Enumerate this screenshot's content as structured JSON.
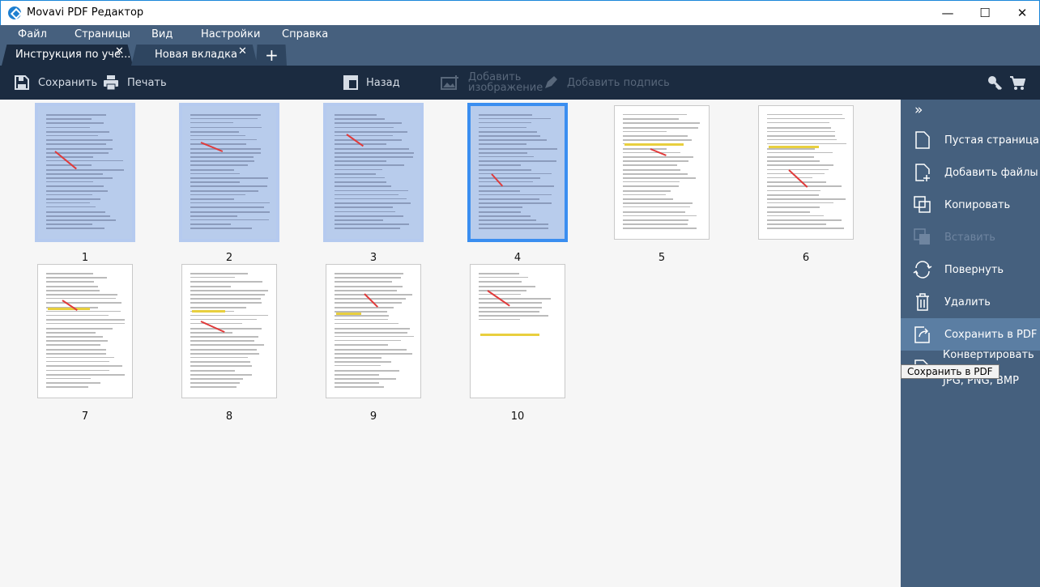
{
  "window": {
    "title": "Movavi PDF Редактор",
    "minimize": "—",
    "maximize": "☐",
    "close": "✕"
  },
  "menu": [
    "Файл",
    "Страницы",
    "Вид",
    "Настройки",
    "Справка"
  ],
  "tabs": [
    {
      "label": "Инструкция по уче...",
      "close": "✕"
    },
    {
      "label": "Новая вкладка",
      "close": "✕"
    }
  ],
  "new_tab": "+",
  "toolbar": {
    "save": "Сохранить",
    "print": "Печать",
    "back": "Назад",
    "add_image_1": "Добавить",
    "add_image_2": "изображение",
    "add_signature": "Добавить подпись"
  },
  "panel": {
    "collapse": "»",
    "items": [
      "Пустая страница",
      "Добавить файлы",
      "Копировать",
      "Вставить",
      "Повернуть",
      "Удалить",
      "Сохранить в PDF"
    ],
    "convert_1": "Конвертировать в",
    "convert_2": "JPG, PNG, BMP"
  },
  "tooltip": "Сохранить в PDF",
  "pages": [
    "1",
    "2",
    "3",
    "4",
    "5",
    "6",
    "7",
    "8",
    "9",
    "10"
  ],
  "selected_pages": [
    1,
    2,
    3,
    4
  ],
  "current_page": 4,
  "colors": {
    "accent": "#3a8ef0",
    "panel": "#45607e",
    "toolbar": "#1b2b40"
  }
}
